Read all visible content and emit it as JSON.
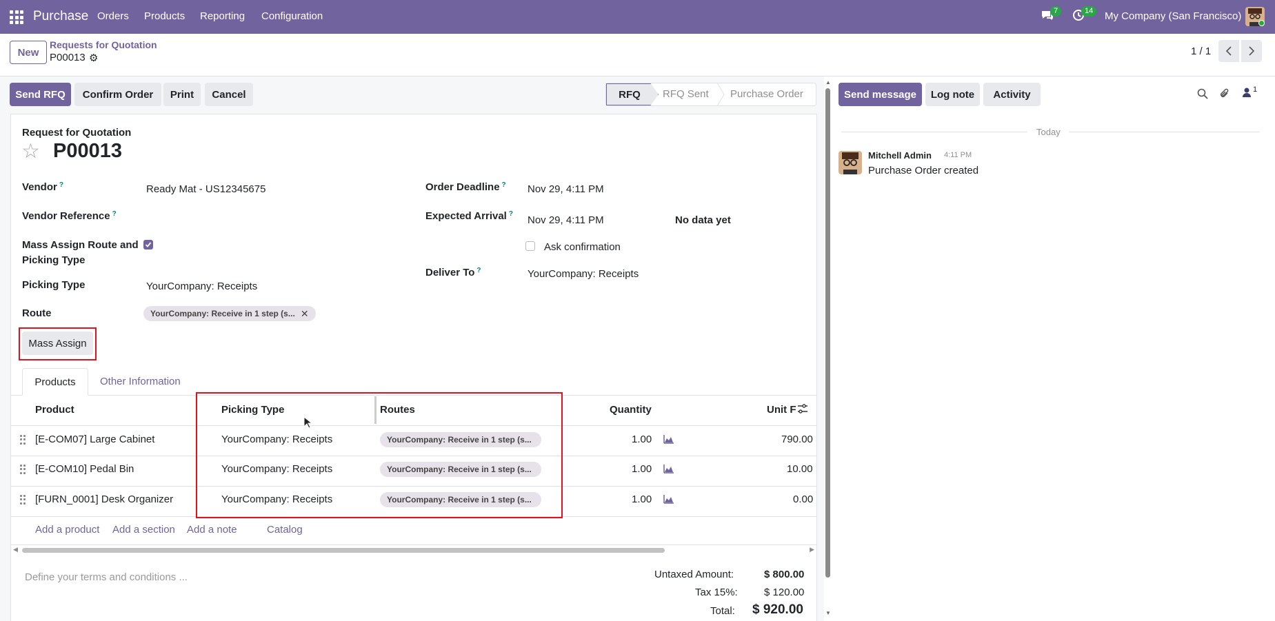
{
  "nav": {
    "brand": "Purchase",
    "menus": [
      "Orders",
      "Products",
      "Reporting",
      "Configuration"
    ],
    "chat_count": "7",
    "activity_count": "14",
    "company": "My Company (San Francisco)"
  },
  "breadcrumb": {
    "new_label": "New",
    "parent": "Requests for Quotation",
    "current": "P00013",
    "pager": "1 / 1"
  },
  "actions": {
    "send_rfq": "Send RFQ",
    "confirm": "Confirm Order",
    "print": "Print",
    "cancel": "Cancel"
  },
  "status": [
    "RFQ",
    "RFQ Sent",
    "Purchase Order"
  ],
  "form": {
    "doc_type": "Request for Quotation",
    "name": "P00013",
    "vendor_label": "Vendor",
    "vendor": "Ready Mat - US12345675",
    "vendor_ref_label": "Vendor Reference",
    "mass_assign_label_1": "Mass Assign Route and",
    "mass_assign_label_2": "Picking Type",
    "picking_type_label": "Picking Type",
    "picking_type": "YourCompany: Receipts",
    "route_label": "Route",
    "route": "YourCompany: Receive in 1 step (s...",
    "mass_assign_btn": "Mass Assign",
    "deadline_label": "Order Deadline",
    "deadline": "Nov 29, 4:11 PM",
    "arrival_label": "Expected Arrival",
    "arrival": "Nov 29, 4:11 PM",
    "no_data": "No data yet",
    "ask_confirm": "Ask confirmation",
    "deliver_label": "Deliver To",
    "deliver": "YourCompany: Receipts"
  },
  "tabs": [
    "Products",
    "Other Information"
  ],
  "table": {
    "headers": [
      "Product",
      "Picking Type",
      "Routes",
      "Quantity",
      "Unit F"
    ],
    "rows": [
      {
        "product": "[E-COM07] Large Cabinet",
        "picking": "YourCompany: Receipts",
        "route": "YourCompany: Receive in 1 step (s...",
        "qty": "1.00",
        "price": "790.00"
      },
      {
        "product": "[E-COM10] Pedal Bin",
        "picking": "YourCompany: Receipts",
        "route": "YourCompany: Receive in 1 step (s...",
        "qty": "1.00",
        "price": "10.00"
      },
      {
        "product": "[FURN_0001] Desk Organizer",
        "picking": "YourCompany: Receipts",
        "route": "YourCompany: Receive in 1 step (s...",
        "qty": "1.00",
        "price": "0.00"
      }
    ],
    "add_product": "Add a product",
    "add_section": "Add a section",
    "add_note": "Add a note",
    "catalog": "Catalog"
  },
  "footer": {
    "terms_placeholder": "Define your terms and conditions ...",
    "untaxed_label": "Untaxed Amount:",
    "untaxed": "$ 800.00",
    "tax_label": "Tax 15%:",
    "tax": "$ 120.00",
    "total_label": "Total:",
    "total": "$ 920.00"
  },
  "chatter": {
    "send_message": "Send message",
    "log_note": "Log note",
    "activity": "Activity",
    "followers": "1",
    "day": "Today",
    "author": "Mitchell Admin",
    "time": "4:11 PM",
    "message": "Purchase Order created"
  },
  "colors": {
    "brand": "#71639e",
    "highlight": "#e5111a",
    "link": "#71639e"
  }
}
